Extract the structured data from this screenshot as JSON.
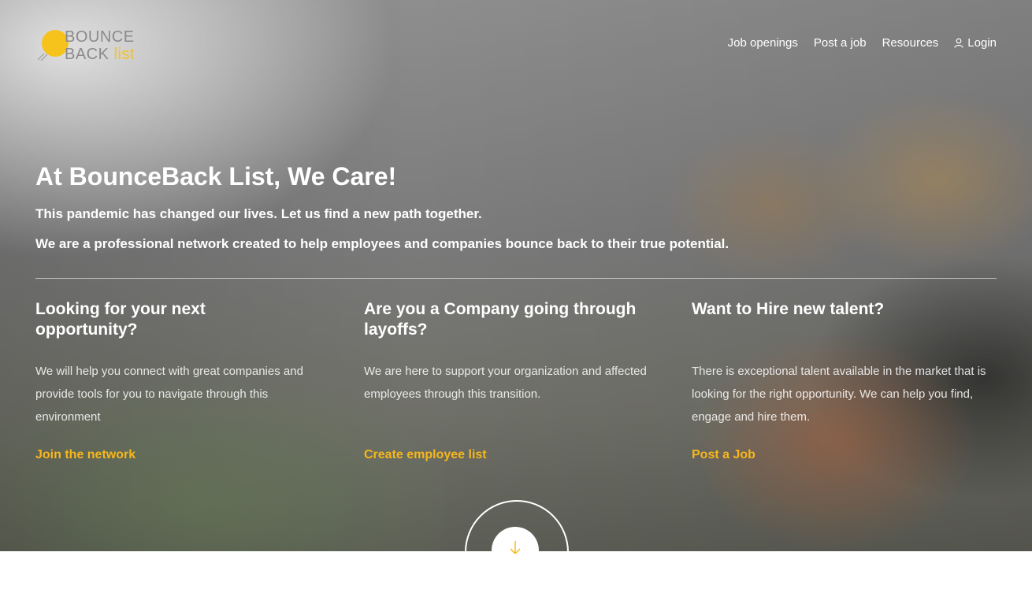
{
  "logo": {
    "line1": "BOUNCE",
    "line2": "BACK",
    "accent": "list",
    "brand_color": "#f6c21c"
  },
  "nav": {
    "items": [
      {
        "label": "Job openings"
      },
      {
        "label": "Post a job"
      },
      {
        "label": "Resources"
      }
    ],
    "login": {
      "label": "Login",
      "icon": "user-icon"
    }
  },
  "hero": {
    "title": "At BounceBack List, We Care!",
    "tagline1": "This pandemic has changed our lives. Let us find a new path together.",
    "tagline2": "We are a professional network created to help employees and companies bounce back to their true potential."
  },
  "columns": [
    {
      "heading": "Looking for your next opportunity?",
      "text": "We will help you connect with great companies and provide tools for you to navigate through this environment",
      "link": "Join the network"
    },
    {
      "heading": "Are you a Company going through layoffs?",
      "text": "We are here to support your organization and affected employees through this transition.",
      "link": "Create employee list"
    },
    {
      "heading": "Want to Hire new talent?",
      "text": "There is exceptional talent available in the market that is looking for the right opportunity. We can help you find, engage and hire them.",
      "link": "Post a Job"
    }
  ],
  "colors": {
    "link": "#f6b71c",
    "text": "#ffffff"
  },
  "scroll": {
    "icon": "scroll-down-icon"
  }
}
